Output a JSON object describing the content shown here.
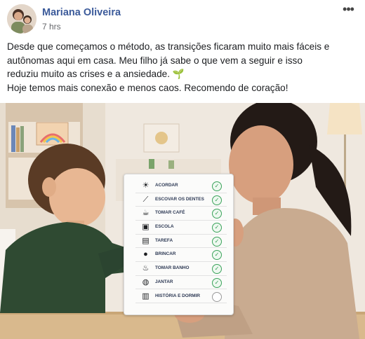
{
  "post": {
    "author": "Mariana Oliveira",
    "time": "7 hrs",
    "more_label": "•••",
    "body_lines": [
      "Desde que começamos o método, as transições ficaram muito mais fáceis e",
      "autônomas aqui em casa. Meu filho já sabe o que vem a seguir e isso",
      "reduziu muito as crises e a ansiedade."
    ],
    "emoji": "🌱",
    "closing": "Hoje temos mais conexão e menos caos. Recomendo de coração!"
  },
  "routine_card": {
    "tasks": [
      {
        "label": "ACORDAR",
        "icon": "sun-icon",
        "glyph": "☀",
        "done": true
      },
      {
        "label": "ESCOVAR OS DENTES",
        "icon": "toothbrush-icon",
        "glyph": "⟋",
        "done": true
      },
      {
        "label": "TOMAR CAFÉ",
        "icon": "coffee-icon",
        "glyph": "☕",
        "done": true
      },
      {
        "label": "ESCOLA",
        "icon": "backpack-icon",
        "glyph": "▣",
        "done": true
      },
      {
        "label": "TAREFA",
        "icon": "book-icon",
        "glyph": "▤",
        "done": true
      },
      {
        "label": "BRINCAR",
        "icon": "ball-icon",
        "glyph": "●",
        "done": true
      },
      {
        "label": "TOMAR BANHO",
        "icon": "bathtub-icon",
        "glyph": "♨",
        "done": true
      },
      {
        "label": "JANTAR",
        "icon": "dinner-icon",
        "glyph": "◍",
        "done": true
      },
      {
        "label": "HISTÓRIA E DORMIR",
        "icon": "storybook-icon",
        "glyph": "▥",
        "done": false
      }
    ],
    "check_glyph": "✓"
  },
  "colors": {
    "author_link": "#3b5a9a",
    "check_green": "#2e9c4f",
    "wall": "#efe9e2",
    "table": "#d9b98d"
  }
}
